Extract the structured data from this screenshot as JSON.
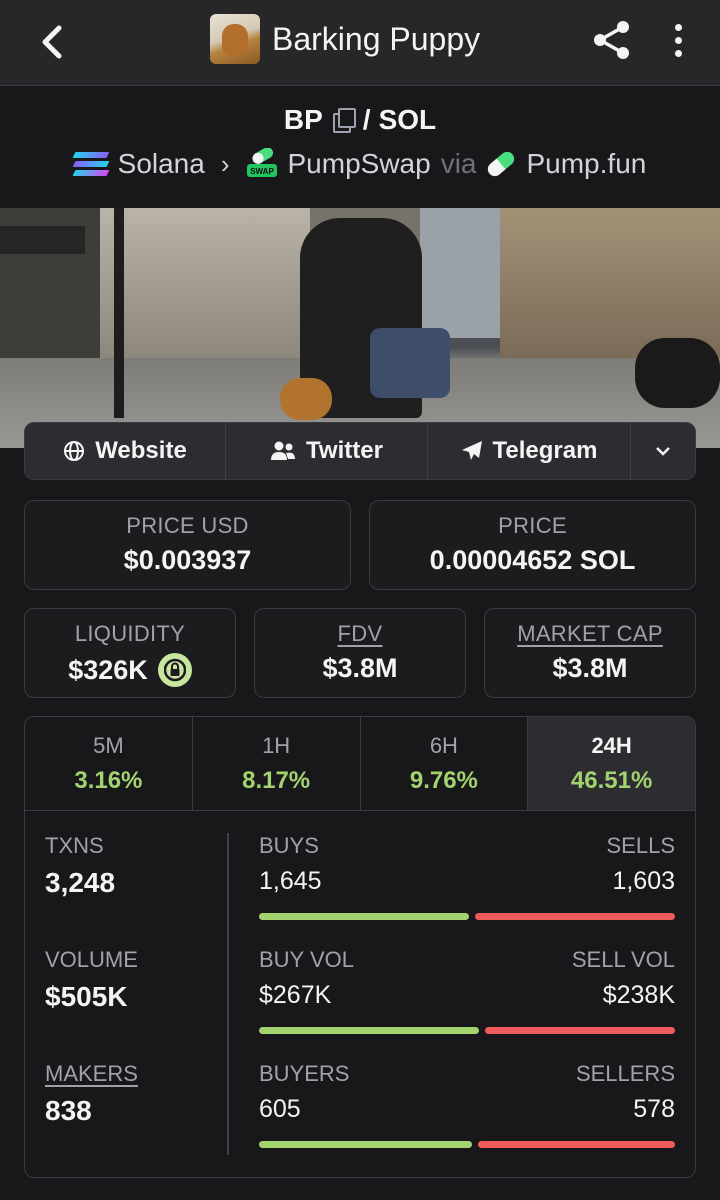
{
  "header": {
    "title": "Barking Puppy",
    "back_icon": "chevron-left-icon",
    "share_icon": "share-icon",
    "menu_icon": "more-vertical-icon"
  },
  "pair": {
    "base": "BP",
    "quote": "SOL",
    "separator": "/",
    "chain": "Solana",
    "dex": "PumpSwap",
    "via_label": "via",
    "launchpad": "Pump.fun",
    "swap_badge": "SWAP"
  },
  "links": [
    {
      "label": "Website",
      "icon": "globe-icon"
    },
    {
      "label": "Twitter",
      "icon": "users-icon"
    },
    {
      "label": "Telegram",
      "icon": "paper-plane-icon"
    }
  ],
  "price": {
    "usd_label": "PRICE USD",
    "usd_value": "$0.003937",
    "native_label": "PRICE",
    "native_value": "0.00004652 SOL"
  },
  "market": {
    "liquidity_label": "LIQUIDITY",
    "liquidity_value": "$326K",
    "fdv_label": "FDV",
    "fdv_value": "$3.8M",
    "mcap_label": "MARKET CAP",
    "mcap_value": "$3.8M"
  },
  "tabs": [
    {
      "label": "5M",
      "change": "3.16%"
    },
    {
      "label": "1H",
      "change": "8.17%"
    },
    {
      "label": "6H",
      "change": "9.76%"
    },
    {
      "label": "24H",
      "change": "46.51%",
      "active": true
    }
  ],
  "stats": {
    "txns_label": "TXNS",
    "txns_value": "3,248",
    "volume_label": "VOLUME",
    "volume_value": "$505K",
    "makers_label": "MAKERS",
    "makers_value": "838",
    "buys_label": "BUYS",
    "buys_value": "1,645",
    "sells_label": "SELLS",
    "sells_value": "1,603",
    "buyvol_label": "BUY VOL",
    "buyvol_value": "$267K",
    "sellvol_label": "SELL VOL",
    "sellvol_value": "$238K",
    "buyers_label": "BUYERS",
    "buyers_value": "605",
    "sellers_label": "SELLERS",
    "sellers_value": "578",
    "buys_ratio": 0.506,
    "buyvol_ratio": 0.529,
    "buyers_ratio": 0.511
  },
  "colors": {
    "positive": "#a3d36f",
    "negative": "#ef5a5a",
    "background": "#18181b"
  }
}
